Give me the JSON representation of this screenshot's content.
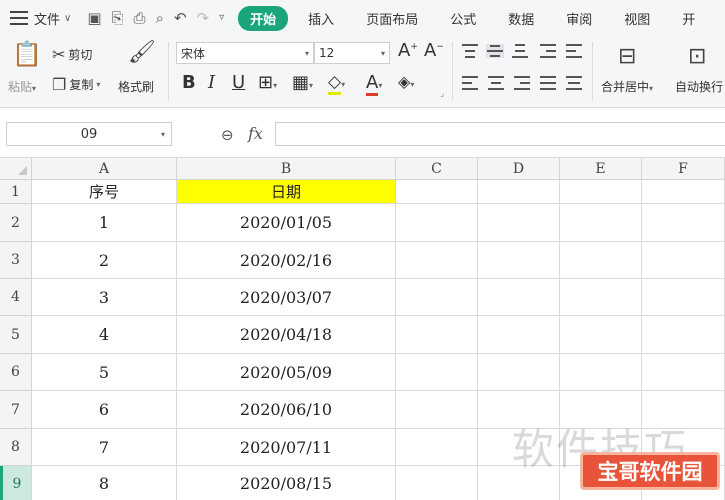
{
  "menubar": {
    "file_label": "文件",
    "tabs": [
      {
        "label": "开始",
        "active": true
      },
      {
        "label": "插入"
      },
      {
        "label": "页面布局"
      },
      {
        "label": "公式"
      },
      {
        "label": "数据"
      },
      {
        "label": "审阅"
      },
      {
        "label": "视图"
      },
      {
        "label": "开"
      }
    ],
    "accent_color": "#1aa57a"
  },
  "ribbon": {
    "paste_label": "粘贴",
    "cut_label": "剪切",
    "copy_label": "复制",
    "format_painter_label": "格式刷",
    "font_name": "宋体",
    "font_size": "12",
    "merge_center_label": "合并居中",
    "wrap_text_label": "自动换行"
  },
  "formula_bar": {
    "name_box": "09",
    "fx_label": "fx",
    "formula": ""
  },
  "sheet": {
    "columns": [
      "A",
      "B",
      "C",
      "D",
      "E",
      "F"
    ],
    "rows": [
      "1",
      "2",
      "3",
      "4",
      "5",
      "6",
      "7",
      "8",
      "9"
    ],
    "selected_row": "9",
    "header_row": {
      "a": "序号",
      "b": "日期"
    },
    "data": [
      {
        "a": "1",
        "b": "2020/01/05"
      },
      {
        "a": "2",
        "b": "2020/02/16"
      },
      {
        "a": "3",
        "b": "2020/03/07"
      },
      {
        "a": "4",
        "b": "2020/04/18"
      },
      {
        "a": "5",
        "b": "2020/05/09"
      },
      {
        "a": "6",
        "b": "2020/06/10"
      },
      {
        "a": "7",
        "b": "2020/07/11"
      },
      {
        "a": "8",
        "b": "2020/08/15"
      }
    ],
    "highlight_color": "#ffff00"
  },
  "watermarks": {
    "text1": "软件技巧",
    "text2": "宝哥软件园"
  }
}
